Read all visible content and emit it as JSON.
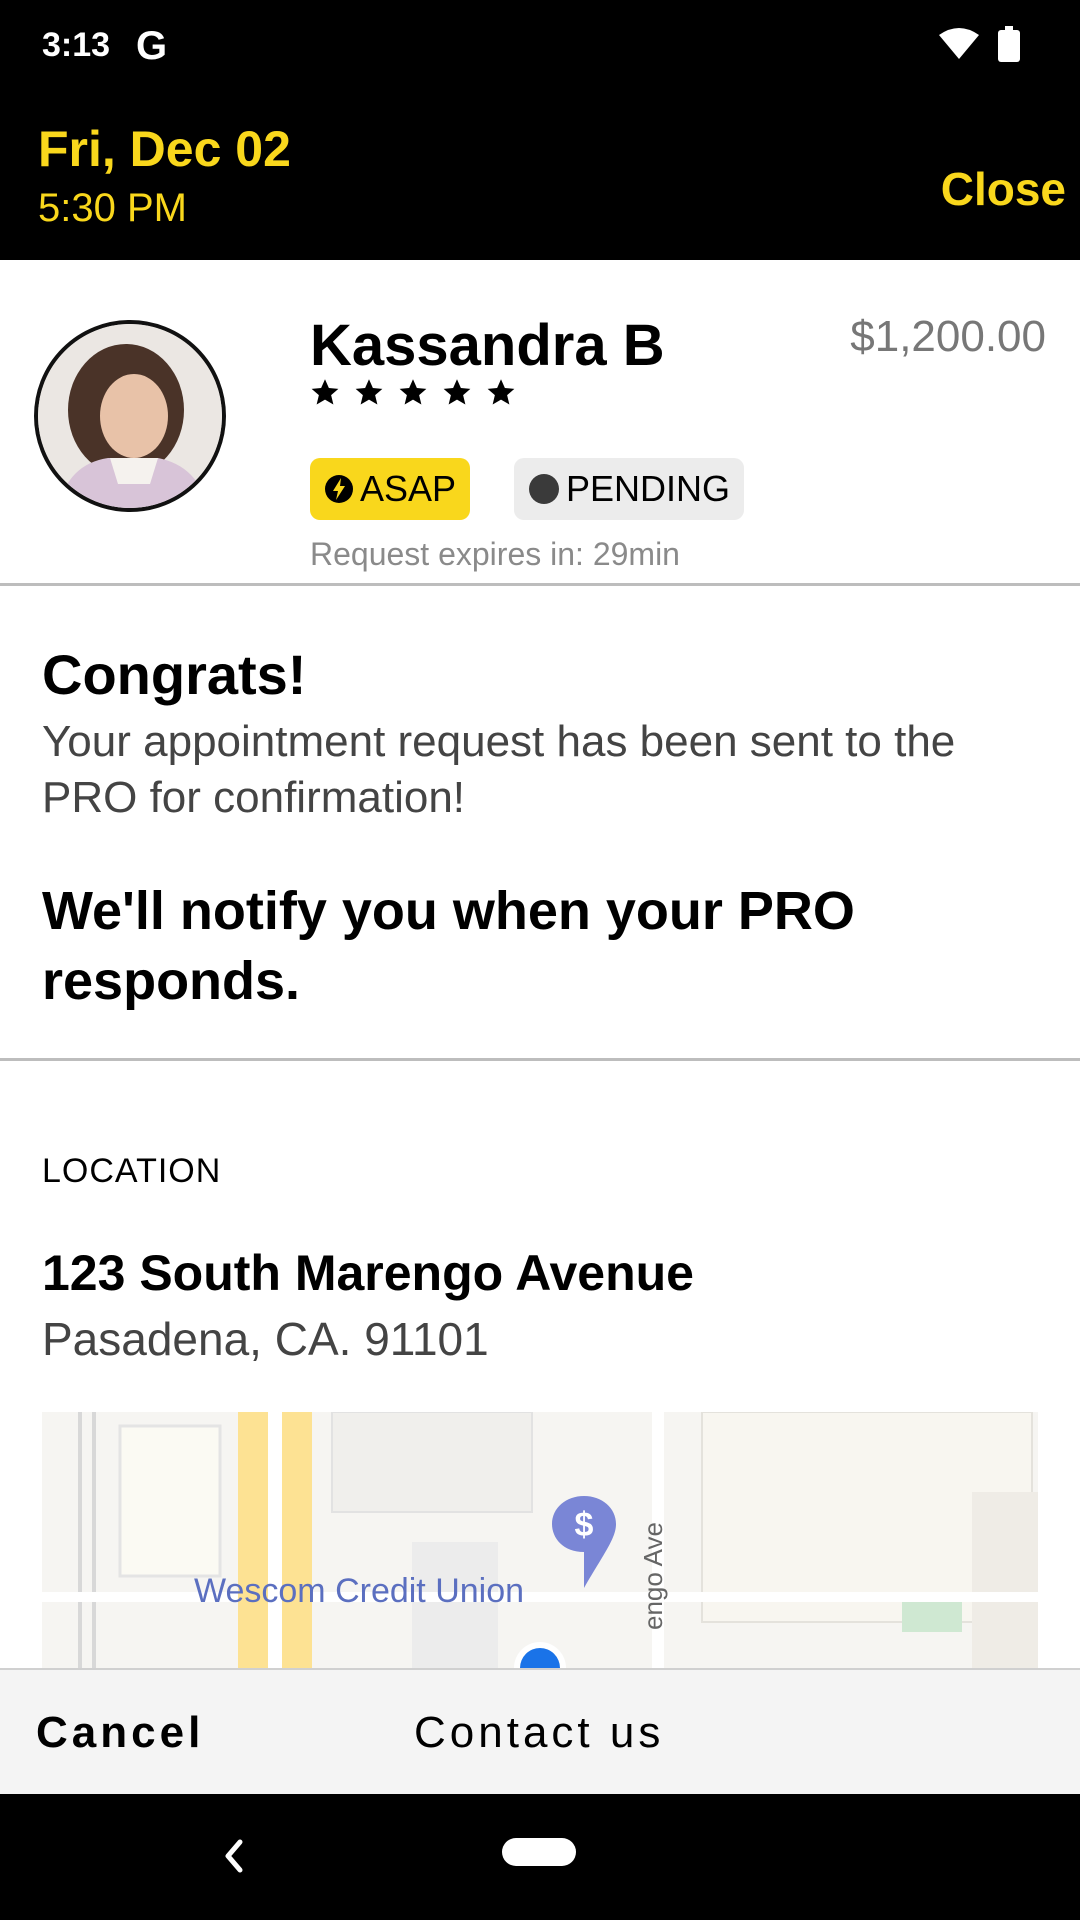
{
  "status_bar": {
    "time": "3:13",
    "g_letter": "G"
  },
  "header": {
    "date": "Fri, Dec 02",
    "time": "5:30 PM",
    "close_label": "Close"
  },
  "pro": {
    "name": "Kassandra B",
    "rating_stars": 5,
    "price": "$1,200.00",
    "badge_asap": "ASAP",
    "badge_pending": "PENDING",
    "expires_text": "Request expires in: 29min"
  },
  "confirmation": {
    "title": "Congrats!",
    "body": "Your appointment request has been sent to the PRO for confirmation!",
    "notify": "We'll notify you when your PRO responds."
  },
  "location": {
    "label": "LOCATION",
    "line1": "123 South Marengo Avenue",
    "line2": "Pasadena, CA. 91101",
    "map_poi_label": "Wescom Credit Union",
    "map_street_label": "engo Ave"
  },
  "actions": {
    "cancel_label": "Cancel",
    "contact_label": "Contact us"
  },
  "colors": {
    "accent": "#F9D71C",
    "header_bg": "#000000",
    "map_road": "#FDE293",
    "poi_text": "#5B6FC0"
  }
}
